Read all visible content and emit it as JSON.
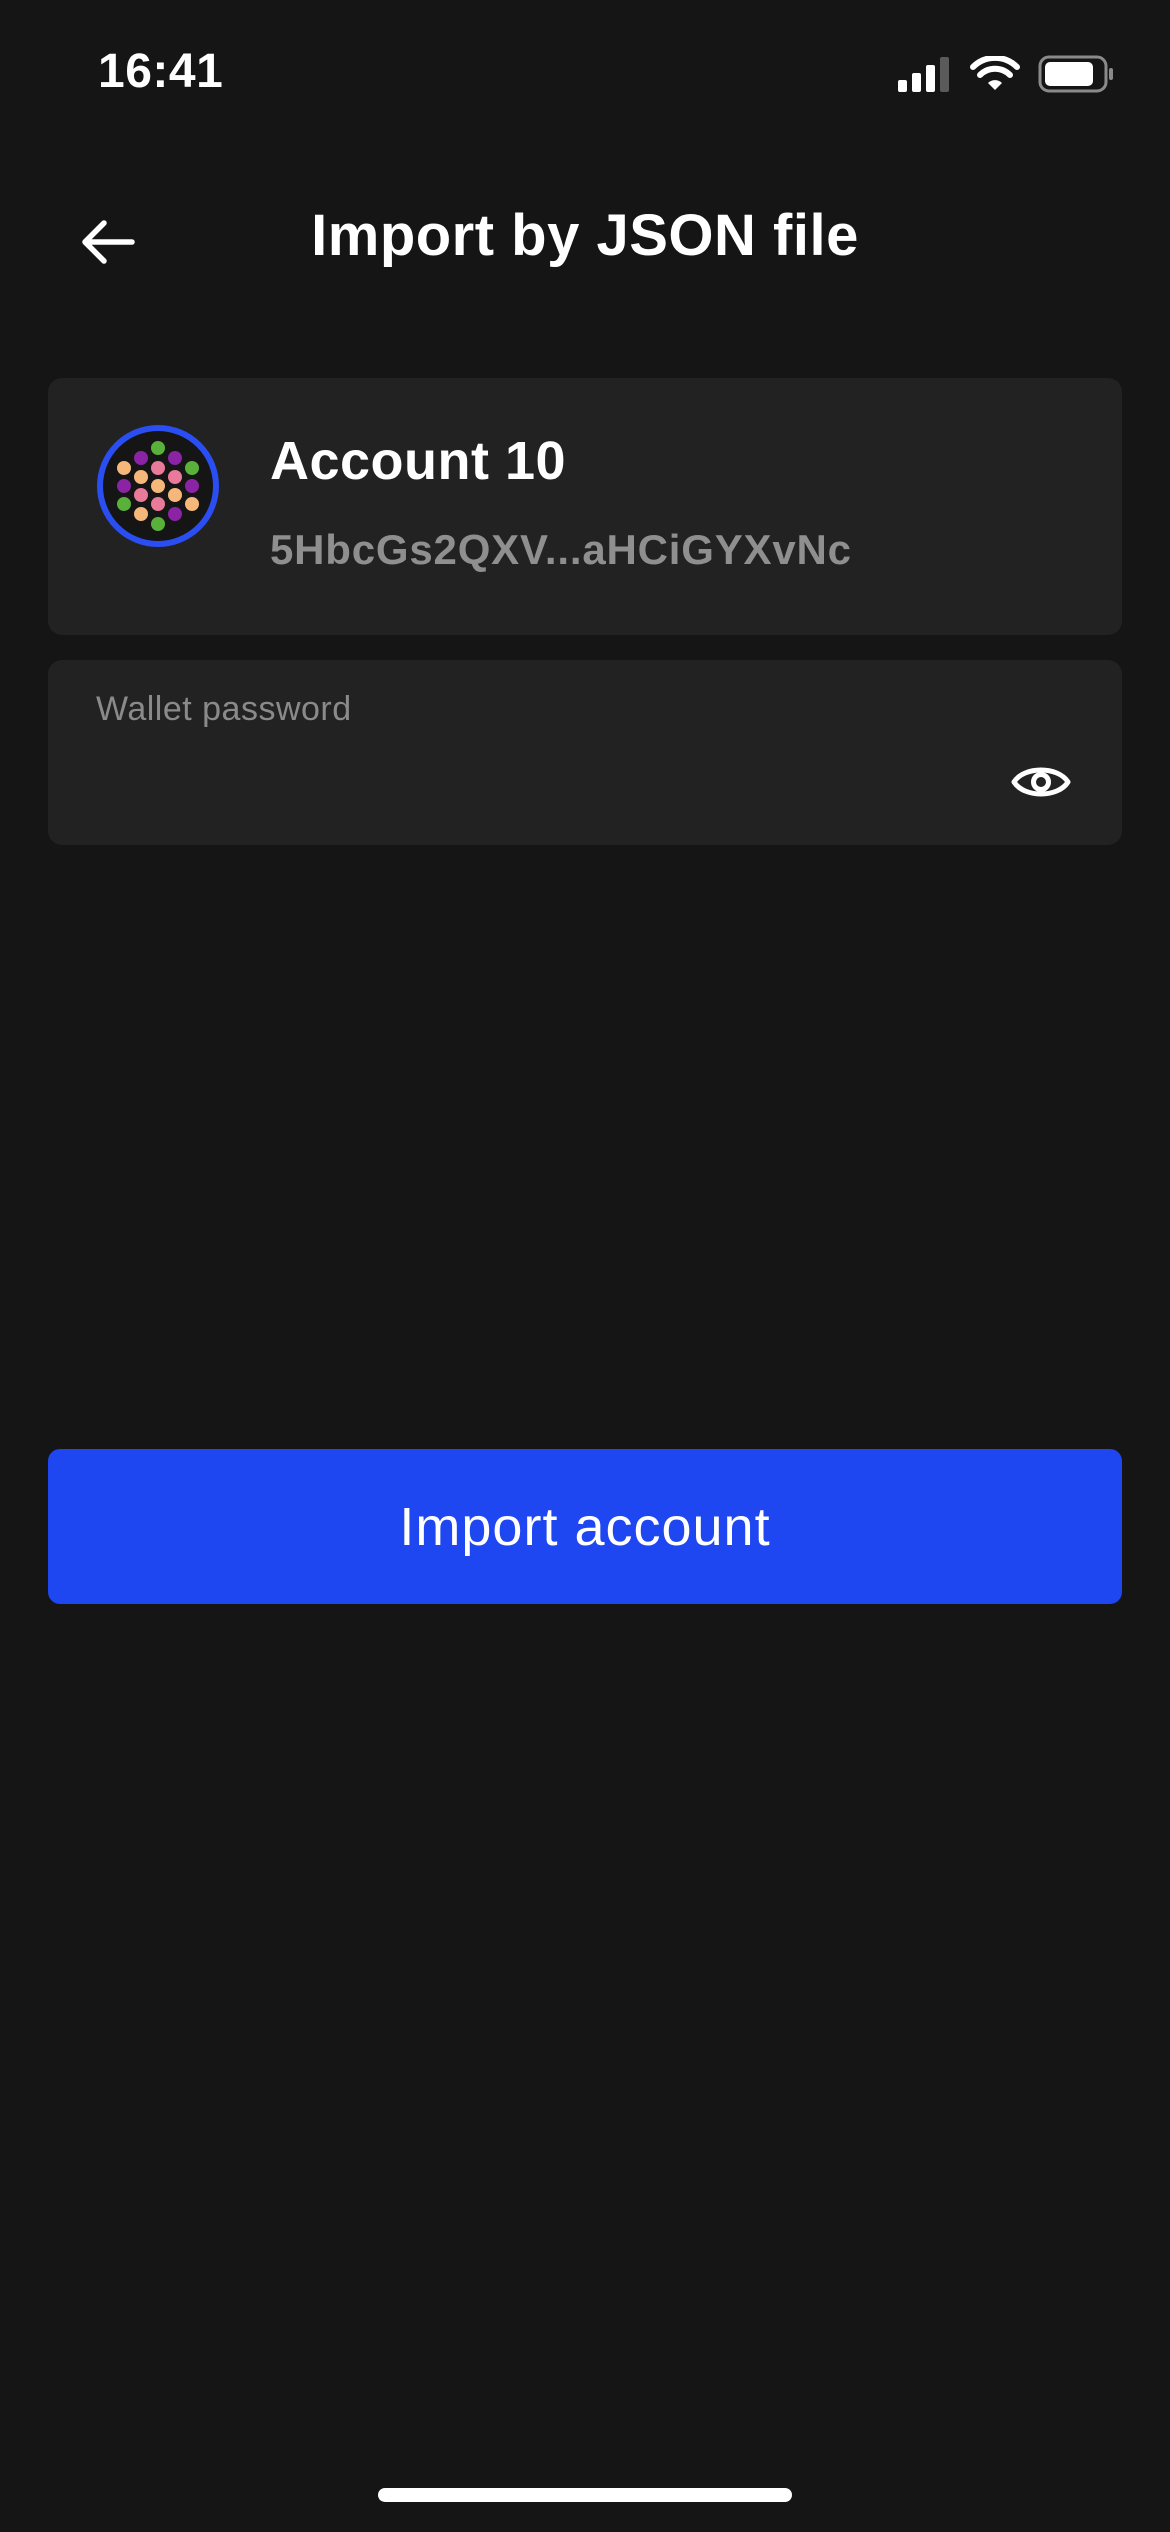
{
  "status_bar": {
    "time": "16:41",
    "icons": [
      "signal-icon",
      "wifi-icon",
      "battery-icon"
    ]
  },
  "header": {
    "back_icon": "arrow-left-icon",
    "title": "Import by JSON file"
  },
  "account": {
    "name": "Account 10",
    "address": "5HbcGs2QXV...aHCiGYXvNc",
    "avatar_icon": "identicon-avatar"
  },
  "password_field": {
    "label": "Wallet password",
    "value": "",
    "toggle_icon": "eye-icon"
  },
  "actions": {
    "import_label": "Import account"
  },
  "colors": {
    "background": "#151515",
    "card": "#222222",
    "accent": "#1e47f2",
    "muted_text": "#8f8f8f"
  }
}
